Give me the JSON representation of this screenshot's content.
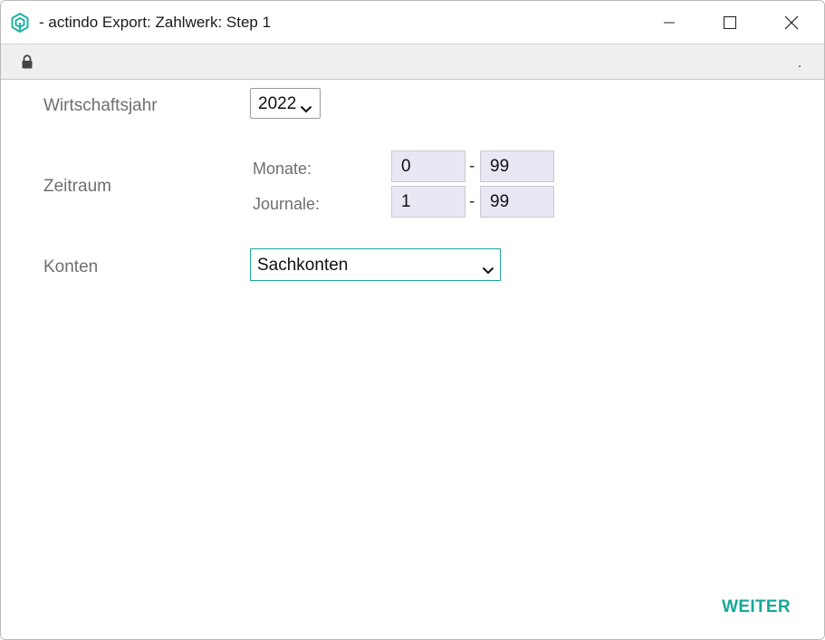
{
  "window": {
    "title": "- actindo Export: Zahlwerk: Step 1",
    "address": "."
  },
  "form": {
    "wirtschaftsjahr_label": "Wirtschaftsjahr",
    "wirtschaftsjahr_value": "2022",
    "zeitraum_label": "Zeitraum",
    "monate_label": "Monate:",
    "monate_from": "0",
    "monate_to": "99",
    "journale_label": "Journale:",
    "journale_from": "1",
    "journale_to": "99",
    "range_separator": "-",
    "konten_label": "Konten",
    "konten_value": "Sachkonten"
  },
  "actions": {
    "next_label": "WEITER"
  },
  "colors": {
    "accent": "#14a89a",
    "input_bg": "#e7e8f4",
    "label": "#6f6f6f"
  },
  "icons": {
    "app": "actindo-logo-icon",
    "lock": "lock-icon",
    "minimize": "minimize-icon",
    "maximize": "maximize-icon",
    "close": "close-icon",
    "dropdown": "chevron-down-icon"
  }
}
